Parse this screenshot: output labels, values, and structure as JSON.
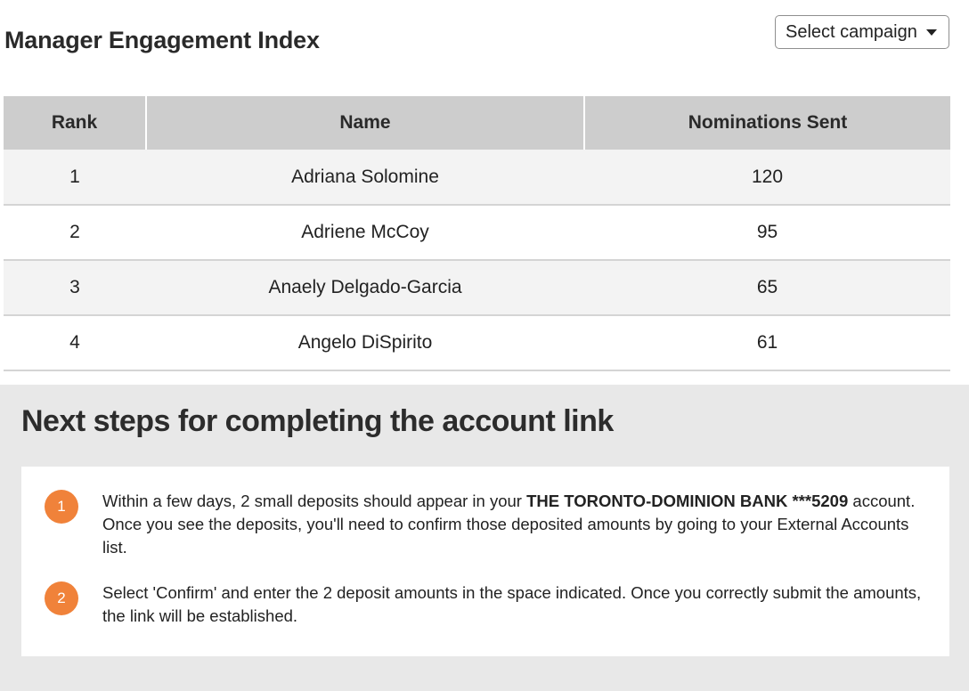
{
  "header": {
    "title": "Manager Engagement Index",
    "campaign_select": "Select campaign"
  },
  "table": {
    "columns": [
      "Rank",
      "Name",
      "Nominations Sent"
    ],
    "rows": [
      {
        "rank": "1",
        "name": "Adriana Solomine",
        "nominations": "120"
      },
      {
        "rank": "2",
        "name": "Adriene McCoy",
        "nominations": "95"
      },
      {
        "rank": "3",
        "name": "Anaely Delgado-Garcia",
        "nominations": "65"
      },
      {
        "rank": "4",
        "name": "Angelo DiSpirito",
        "nominations": "61"
      }
    ]
  },
  "steps": {
    "title": "Next steps for completing the account link",
    "items": [
      {
        "num": "1",
        "text_before": "Within a few days, 2 small deposits should appear in your ",
        "bank": "THE TORONTO-DOMINION BANK ***5209",
        "text_after": " account. Once you see the deposits, you'll need to confirm those deposited amounts by going to your External Accounts list."
      },
      {
        "num": "2",
        "text": "Select 'Confirm' and enter the 2 deposit amounts in the space indicated. Once you correctly submit the amounts, the link will be established."
      }
    ]
  },
  "colors": {
    "accent": "#f0823a",
    "table_header_bg": "#cdcdcd",
    "panel_bg": "#e8e8e8"
  }
}
